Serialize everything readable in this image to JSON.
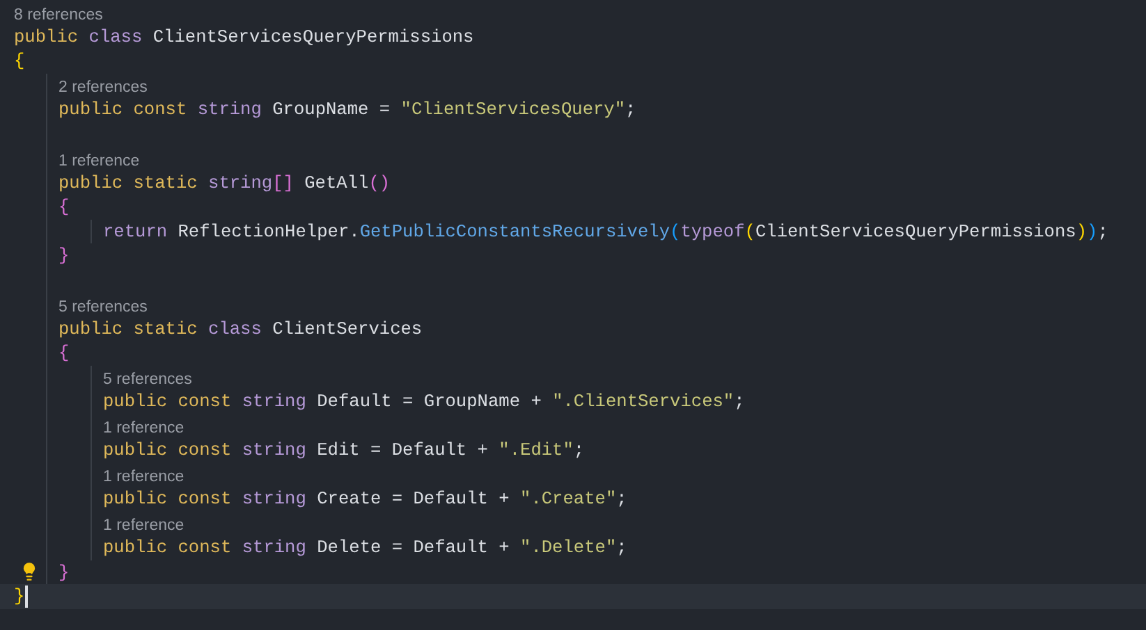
{
  "editor": {
    "lines": [
      {
        "kind": "lens",
        "text": "8 references"
      },
      {
        "kind": "code",
        "tokens": [
          {
            "text": "public ",
            "kind": "kw"
          },
          {
            "text": "class",
            "kind": "type"
          },
          {
            "text": " ClientServicesQueryPermissions",
            "kind": "plain"
          }
        ]
      },
      {
        "kind": "code",
        "tokens": [
          {
            "text": "{",
            "kind": "brace1"
          }
        ]
      },
      {
        "kind": "block",
        "children": [
          {
            "kind": "lens",
            "text": "2 references"
          },
          {
            "kind": "code",
            "tokens": [
              {
                "text": "public const ",
                "kind": "kw"
              },
              {
                "text": "string",
                "kind": "type"
              },
              {
                "text": " GroupName = ",
                "kind": "plain"
              },
              {
                "text": "\"ClientServicesQuery\"",
                "kind": "str"
              },
              {
                "text": ";",
                "kind": "plain"
              }
            ]
          },
          {
            "kind": "blank"
          },
          {
            "kind": "lens",
            "text": "1 reference"
          },
          {
            "kind": "code",
            "tokens": [
              {
                "text": "public static ",
                "kind": "kw"
              },
              {
                "text": "string",
                "kind": "type"
              },
              {
                "text": "[]",
                "kind": "brace2"
              },
              {
                "text": " GetAll",
                "kind": "plain"
              },
              {
                "text": "()",
                "kind": "brace2"
              }
            ]
          },
          {
            "kind": "code",
            "tokens": [
              {
                "text": "{",
                "kind": "brace2"
              }
            ]
          },
          {
            "kind": "block",
            "children": [
              {
                "kind": "code",
                "tokens": [
                  {
                    "text": "return",
                    "kind": "type"
                  },
                  {
                    "text": " ReflectionHelper.",
                    "kind": "plain"
                  },
                  {
                    "text": "GetPublicConstantsRecursively",
                    "kind": "method"
                  },
                  {
                    "text": "(",
                    "kind": "brace3"
                  },
                  {
                    "text": "typeof",
                    "kind": "type"
                  },
                  {
                    "text": "(",
                    "kind": "brace1"
                  },
                  {
                    "text": "ClientServicesQueryPermissions",
                    "kind": "plain"
                  },
                  {
                    "text": ")",
                    "kind": "brace1"
                  },
                  {
                    "text": ")",
                    "kind": "brace3"
                  },
                  {
                    "text": ";",
                    "kind": "plain"
                  }
                ]
              }
            ]
          },
          {
            "kind": "code",
            "tokens": [
              {
                "text": "}",
                "kind": "brace2"
              }
            ]
          },
          {
            "kind": "blank"
          },
          {
            "kind": "lens",
            "text": "5 references"
          },
          {
            "kind": "code",
            "tokens": [
              {
                "text": "public static ",
                "kind": "kw"
              },
              {
                "text": "class",
                "kind": "type"
              },
              {
                "text": " ClientServices",
                "kind": "plain"
              }
            ]
          },
          {
            "kind": "code",
            "tokens": [
              {
                "text": "{",
                "kind": "brace2"
              }
            ]
          },
          {
            "kind": "block",
            "children": [
              {
                "kind": "lens",
                "text": "5 references"
              },
              {
                "kind": "code",
                "tokens": [
                  {
                    "text": "public const ",
                    "kind": "kw"
                  },
                  {
                    "text": "string",
                    "kind": "type"
                  },
                  {
                    "text": " Default = GroupName + ",
                    "kind": "plain"
                  },
                  {
                    "text": "\".ClientServices\"",
                    "kind": "str"
                  },
                  {
                    "text": ";",
                    "kind": "plain"
                  }
                ]
              },
              {
                "kind": "lens",
                "text": "1 reference"
              },
              {
                "kind": "code",
                "tokens": [
                  {
                    "text": "public const ",
                    "kind": "kw"
                  },
                  {
                    "text": "string",
                    "kind": "type"
                  },
                  {
                    "text": " Edit = Default + ",
                    "kind": "plain"
                  },
                  {
                    "text": "\".Edit\"",
                    "kind": "str"
                  },
                  {
                    "text": ";",
                    "kind": "plain"
                  }
                ]
              },
              {
                "kind": "lens",
                "text": "1 reference"
              },
              {
                "kind": "code",
                "tokens": [
                  {
                    "text": "public const ",
                    "kind": "kw"
                  },
                  {
                    "text": "string",
                    "kind": "type"
                  },
                  {
                    "text": " Create = Default + ",
                    "kind": "plain"
                  },
                  {
                    "text": "\".Create\"",
                    "kind": "str"
                  },
                  {
                    "text": ";",
                    "kind": "plain"
                  }
                ]
              },
              {
                "kind": "lens",
                "text": "1 reference"
              },
              {
                "kind": "code",
                "tokens": [
                  {
                    "text": "public const ",
                    "kind": "kw"
                  },
                  {
                    "text": "string",
                    "kind": "type"
                  },
                  {
                    "text": " Delete = Default + ",
                    "kind": "plain"
                  },
                  {
                    "text": "\".Delete\"",
                    "kind": "str"
                  },
                  {
                    "text": ";",
                    "kind": "plain"
                  }
                ]
              }
            ]
          },
          {
            "kind": "code",
            "lightbulb": true,
            "tokens": [
              {
                "text": "}",
                "kind": "brace2"
              }
            ]
          }
        ]
      },
      {
        "kind": "code",
        "current": true,
        "tokens": [
          {
            "text": "}",
            "kind": "brace1"
          }
        ]
      }
    ]
  }
}
